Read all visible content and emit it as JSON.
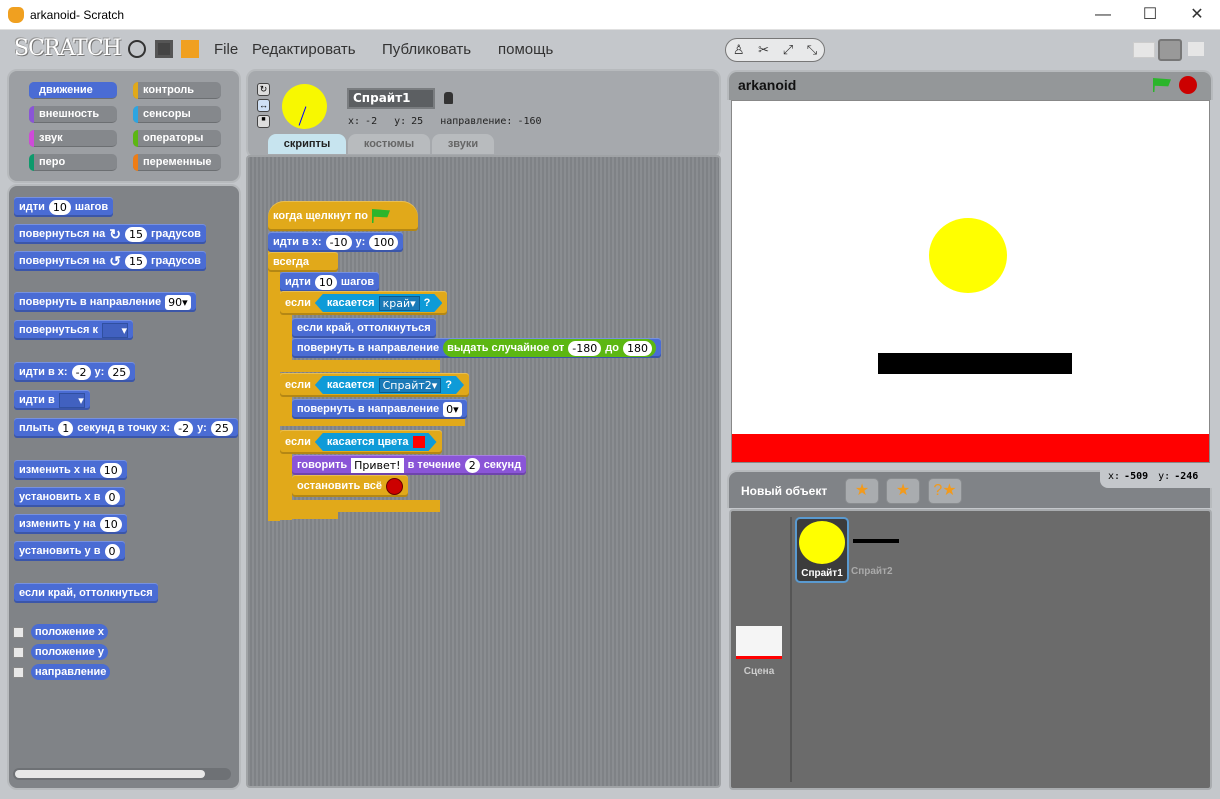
{
  "window": {
    "title": "arkanoid- Scratch",
    "minimize": "—",
    "maximize": "☐",
    "close": "✕"
  },
  "menu": {
    "logo": "SCRATCH",
    "items": [
      "File",
      "Редактировать",
      "Публиковать",
      "помощь"
    ]
  },
  "categories": [
    {
      "label": "движение",
      "color": "#4a6cd4"
    },
    {
      "label": "контроль",
      "color": "#e1a91a"
    },
    {
      "label": "внешность",
      "color": "#8a55d7"
    },
    {
      "label": "сенсоры",
      "color": "#2ca5e2"
    },
    {
      "label": "звук",
      "color": "#cf4ad9"
    },
    {
      "label": "операторы",
      "color": "#5cb712"
    },
    {
      "label": "перо",
      "color": "#0e9a6c"
    },
    {
      "label": "переменные",
      "color": "#ee7d16"
    }
  ],
  "selected_category": "движение",
  "palette_blocks": [
    {
      "cat": "m",
      "parts": [
        {
          "t": "идти"
        },
        {
          "n": "10"
        },
        {
          "t": "шагов"
        }
      ]
    },
    {
      "cat": "m",
      "parts": [
        {
          "t": "повернуться на"
        },
        {
          "icon": "turn-cw"
        },
        {
          "n": "15"
        },
        {
          "t": "градусов"
        }
      ]
    },
    {
      "cat": "m",
      "parts": [
        {
          "t": "повернуться на"
        },
        {
          "icon": "turn-ccw"
        },
        {
          "n": "15"
        },
        {
          "t": "градусов"
        }
      ]
    },
    {
      "cat": "m",
      "parts": [
        {
          "t": "повернуть в направление"
        },
        {
          "d": "90▾"
        }
      ]
    },
    {
      "cat": "m",
      "parts": [
        {
          "t": "повернуться к"
        },
        {
          "dm": "▾"
        }
      ]
    },
    {
      "cat": "m",
      "parts": [
        {
          "t": "идти в x:"
        },
        {
          "n": "-2"
        },
        {
          "t": "y:"
        },
        {
          "n": "25"
        }
      ]
    },
    {
      "cat": "m",
      "parts": [
        {
          "t": "идти в"
        },
        {
          "dm": "▾"
        }
      ]
    },
    {
      "cat": "m",
      "parts": [
        {
          "t": "плыть"
        },
        {
          "n": "1"
        },
        {
          "t": "секунд в точку x:"
        },
        {
          "n": "-2"
        },
        {
          "t": "y:"
        },
        {
          "n": "25"
        }
      ]
    },
    {
      "cat": "m",
      "parts": [
        {
          "t": "изменить x на"
        },
        {
          "n": "10"
        }
      ]
    },
    {
      "cat": "m",
      "parts": [
        {
          "t": "установить x в"
        },
        {
          "n": "0"
        }
      ]
    },
    {
      "cat": "m",
      "parts": [
        {
          "t": "изменить y на"
        },
        {
          "n": "10"
        }
      ]
    },
    {
      "cat": "m",
      "parts": [
        {
          "t": "установить y в"
        },
        {
          "n": "0"
        }
      ]
    },
    {
      "cat": "m",
      "parts": [
        {
          "t": "если край, оттолкнуться"
        }
      ]
    }
  ],
  "palette_reporters": [
    {
      "label": "положение x",
      "checked": false
    },
    {
      "label": "положение y",
      "checked": false
    },
    {
      "label": "направление",
      "checked": false
    }
  ],
  "sprite": {
    "name": "Спрайт1",
    "x_label": "x:",
    "x": "-2",
    "y_label": "y:",
    "y": "25",
    "dir_label": "направление:",
    "direction": "-160"
  },
  "tabs": [
    {
      "label": "скрипты",
      "active": true
    },
    {
      "label": "костюмы",
      "active": false
    },
    {
      "label": "звуки",
      "active": false
    }
  ],
  "script_blocks": [
    {
      "cat": "c",
      "parts": [
        {
          "t": "когда щелкнут по"
        },
        {
          "icon": "green-flag"
        }
      ]
    },
    {
      "cat": "m",
      "parts": [
        {
          "t": "идти в x:"
        },
        {
          "n": "-10"
        },
        {
          "t": "y:"
        },
        {
          "n": "100"
        }
      ]
    },
    {
      "cat": "c",
      "parts": [
        {
          "t": "всегда"
        }
      ]
    },
    {
      "cat": "m",
      "parts": [
        {
          "t": "идти"
        },
        {
          "n": "10"
        },
        {
          "t": "шагов"
        }
      ]
    },
    {
      "cat": "c",
      "parts": [
        {
          "t": "если"
        },
        {
          "b": {
            "cat": "s",
            "parts": [
              {
                "t": "касается"
              },
              {
                "dk": "край▾"
              },
              {
                "t": "?"
              }
            ]
          }
        }
      ]
    },
    {
      "cat": "m",
      "parts": [
        {
          "t": "если край, оттолкнуться"
        }
      ]
    },
    {
      "cat": "m",
      "parts": [
        {
          "t": "повернуть в направление"
        },
        {
          "r": {
            "cat": "o",
            "parts": [
              {
                "t": "выдать случайное от"
              },
              {
                "n": "-180"
              },
              {
                "t": "до"
              },
              {
                "n": "180"
              }
            ]
          }
        }
      ]
    },
    {
      "cat": "c",
      "parts": [
        {
          "t": "если"
        },
        {
          "b": {
            "cat": "s",
            "parts": [
              {
                "t": "касается"
              },
              {
                "dk": "Спрайт2▾"
              },
              {
                "t": "?"
              }
            ]
          }
        }
      ]
    },
    {
      "cat": "m",
      "parts": [
        {
          "t": "повернуть в направление"
        },
        {
          "d": "0▾"
        }
      ]
    },
    {
      "cat": "c",
      "parts": [
        {
          "t": "если"
        },
        {
          "b": {
            "cat": "s",
            "parts": [
              {
                "t": "касается цвета"
              },
              {
                "c": "#ff0000"
              }
            ]
          }
        }
      ]
    },
    {
      "cat": "l",
      "parts": [
        {
          "t": "говорить"
        },
        {
          "s": "Привет!"
        },
        {
          "t": "в течение"
        },
        {
          "n": "2"
        },
        {
          "t": "секунд"
        }
      ]
    },
    {
      "cat": "c",
      "parts": [
        {
          "t": "остановить всё"
        },
        {
          "icon": "stop"
        }
      ]
    }
  ],
  "stage": {
    "title": "arkanoid",
    "mouse_x_label": "x:",
    "mouse_x": "-509",
    "mouse_y_label": "y:",
    "mouse_y": "-246"
  },
  "new_sprite": {
    "label": "Новый объект"
  },
  "sprites": [
    {
      "name": "Спрайт1",
      "selected": true
    },
    {
      "name": "Спрайт2",
      "selected": false
    }
  ],
  "stage_thumb": {
    "label": "Сцена"
  },
  "colors": {
    "motion": "#4a6cd4",
    "control": "#e1a91a",
    "sensing": "#0e9bd8",
    "operators": "#5cb712",
    "looks": "#8a55d7",
    "ball": "#ffff00",
    "wall": "#ff0000",
    "paddle": "#000000"
  }
}
